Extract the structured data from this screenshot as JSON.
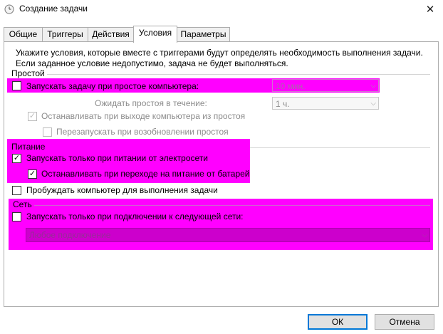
{
  "window": {
    "title": "Создание задачи",
    "close_glyph": "✕"
  },
  "tabs": [
    {
      "label": "Общие"
    },
    {
      "label": "Триггеры"
    },
    {
      "label": "Действия"
    },
    {
      "label": "Условия"
    },
    {
      "label": "Параметры"
    }
  ],
  "active_tab": "Условия",
  "intro": {
    "line1": "Укажите условия, которые вместе с триггерами будут определять необходимость выполнения задачи.",
    "line2": "Если заданное условие недопустимо, задача не будет выполняться."
  },
  "idle": {
    "group_label": "Простой",
    "start_if_idle": {
      "label": "Запускать задачу при простое компьютера:",
      "checked": false
    },
    "idle_duration_value": "10 мин.",
    "wait_label": "Ожидать простоя в течение:",
    "wait_value": "1 ч.",
    "stop_on_idle_end": {
      "label": "Останавливать при выходе компьютера из простоя",
      "checked": true
    },
    "restart_on_idle": {
      "label": "Перезапускать при возобновлении простоя",
      "checked": false
    }
  },
  "power": {
    "group_label": "Питание",
    "ac_only": {
      "label": "Запускать только при питании от электросети",
      "checked": true
    },
    "stop_on_battery": {
      "label": "Останавливать при переходе на питание от батарей",
      "checked": true
    },
    "wake": {
      "label": "Пробуждать компьютер для выполнения задачи",
      "checked": false
    }
  },
  "network": {
    "group_label": "Сеть",
    "network_only": {
      "label": "Запускать только при подключении к следующей сети:",
      "checked": false
    },
    "connection_value": "Любое подключение"
  },
  "buttons": {
    "ok": "ОК",
    "cancel": "Отмена"
  },
  "colors": {
    "highlight": "#ff00ff",
    "disabled_text": "#8c8c8c",
    "default_button_border": "#0078d7"
  }
}
